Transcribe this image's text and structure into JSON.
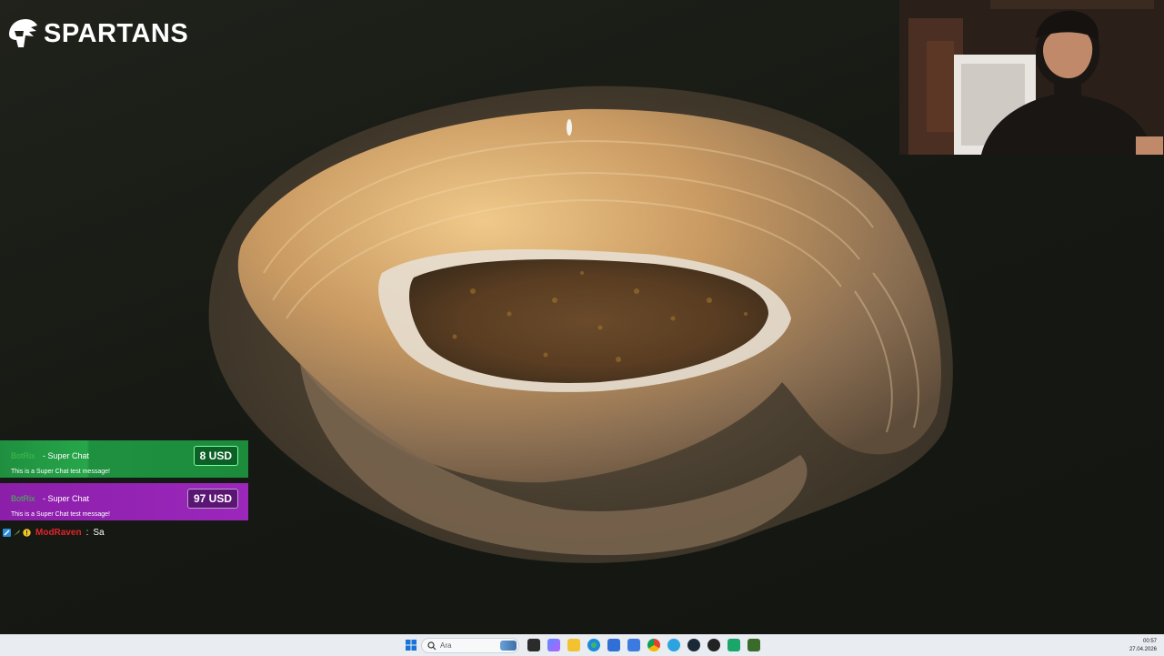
{
  "brand": {
    "name": "SPARTANS"
  },
  "superchats": [
    {
      "user": "BotRix",
      "type": "- Super Chat",
      "message": "This is a Super Chat test message!",
      "amount": "8 USD",
      "color": "#1f8f3f"
    },
    {
      "user": "BotRix",
      "type": "- Super Chat",
      "message": "This is a Super Chat test message!",
      "amount": "97 USD",
      "color": "#8c1faa"
    }
  ],
  "chat": {
    "user": "ModRaven",
    "separator": ":",
    "message": "Sa"
  },
  "taskbar": {
    "search_placeholder": "Ara",
    "time": "00:57",
    "date": "27.04.2026"
  }
}
